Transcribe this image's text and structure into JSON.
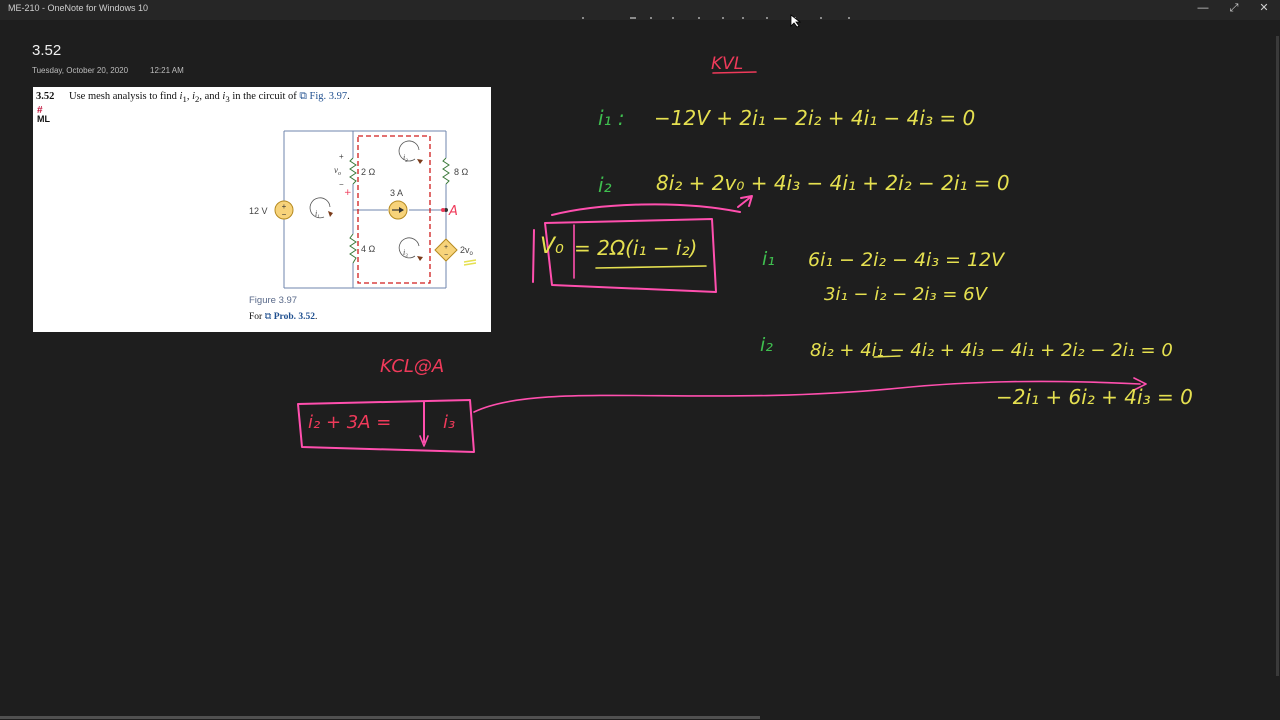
{
  "window": {
    "title": "ME-210 - OneNote for Windows 10",
    "minimize": "—",
    "maximize": "⤢",
    "close": "✕"
  },
  "page": {
    "title": "3.52",
    "date": "Tuesday, October 20, 2020",
    "time": "12:21 AM"
  },
  "problem": {
    "number": "3.52",
    "text_before": "Use mesh analysis to find ",
    "v1": "i",
    "v1_sub": "1",
    "sep1": ", ",
    "v2": "i",
    "v2_sub": "2",
    "sep2": ", and ",
    "v3": "i",
    "v3_sub": "3",
    "text_after": " in the circuit of ",
    "fig_link": "Fig. 3.97",
    "period": ".",
    "badge_hash": "#",
    "badge_ml": "ML",
    "figure_caption": "Figure 3.97",
    "for_label": "For ",
    "prob_link": "Prob. 3.52",
    "prob_period": "."
  },
  "circuit": {
    "source_12v": "12 V",
    "r_2": "2 Ω",
    "r_8": "8 Ω",
    "r_4": "4 Ω",
    "source_3a": "3 A",
    "vo_label": "v",
    "vo_sub": "o",
    "dep_coeff": "2v",
    "dep_sub": "o",
    "plus": "+",
    "minus": "−",
    "mesh1": "i",
    "mesh1_sub": "1",
    "mesh2": "i",
    "mesh2_sub": "2",
    "mesh3": "i",
    "mesh3_sub": "3",
    "node_a": "A"
  },
  "ink": {
    "kvl": "KVL",
    "mesh_i1": "i₁ :",
    "eq_i1": "−12V + 2i₁ − 2i₂ + 4i₁ − 4i₃ = 0",
    "mesh_i2": "i₂",
    "eq_i2": "8i₂ + 2v₀ + 4i₃ − 4i₁ + 2i₂ − 2i₁ = 0",
    "vo_def_lhs": "V₀",
    "vo_def_rhs": "= 2Ω(i₁ − i₂)",
    "mesh_i1b": "i₁",
    "eq_i1b": "6i₁ − 2i₂ − 4i₃ = 12V",
    "eq_i1c": "3i₁ − i₂ − 2i₃ = 6V",
    "mesh_i2b": "i₂",
    "eq_i2b": "8i₂ + 4i₁ − 4i₂ + 4i₃ − 4i₁ + 2i₂ − 2i₁ = 0",
    "eq_i2c": "−2i₁ + 6i₂ + 4i₃ = 0",
    "kcl": "KCL@A",
    "kcl_eq_left": "i₂ + 3A =",
    "kcl_eq_right": "i₃"
  },
  "colors": {
    "background": "#1e1e1e",
    "ink_yellow": "#e5e050",
    "ink_green": "#3fbf4f",
    "ink_pink": "#ff4fae",
    "ink_red": "#ef3a5a"
  }
}
